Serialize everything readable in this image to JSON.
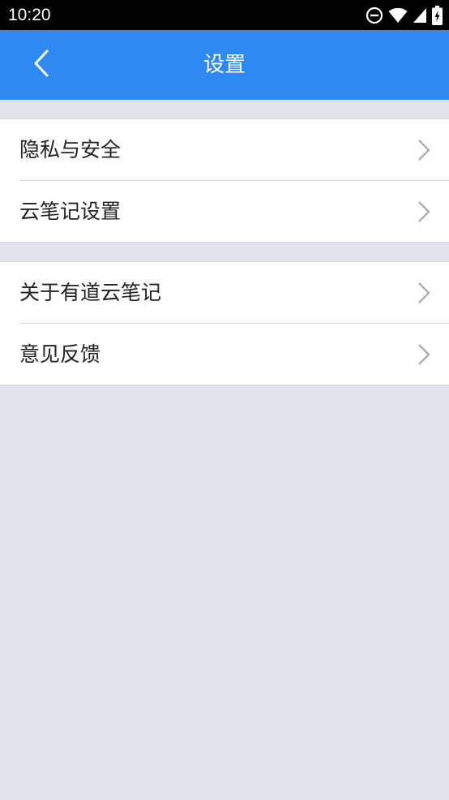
{
  "status_bar": {
    "time": "10:20",
    "icons": [
      "do-not-disturb-icon",
      "wifi-icon",
      "cellular-signal-icon",
      "battery-charging-icon"
    ]
  },
  "app_bar": {
    "title": "设置",
    "back_icon": "back-arrow-icon",
    "background_color": "#2f89f0"
  },
  "settings": {
    "groups": [
      {
        "items": [
          {
            "label": "隐私与安全"
          },
          {
            "label": "云笔记设置"
          }
        ]
      },
      {
        "items": [
          {
            "label": "关于有道云笔记"
          },
          {
            "label": "意见反馈"
          }
        ]
      }
    ]
  },
  "colors": {
    "page_background": "#e1e4ea",
    "row_background": "#ffffff",
    "chevron": "#a6a6a6"
  }
}
